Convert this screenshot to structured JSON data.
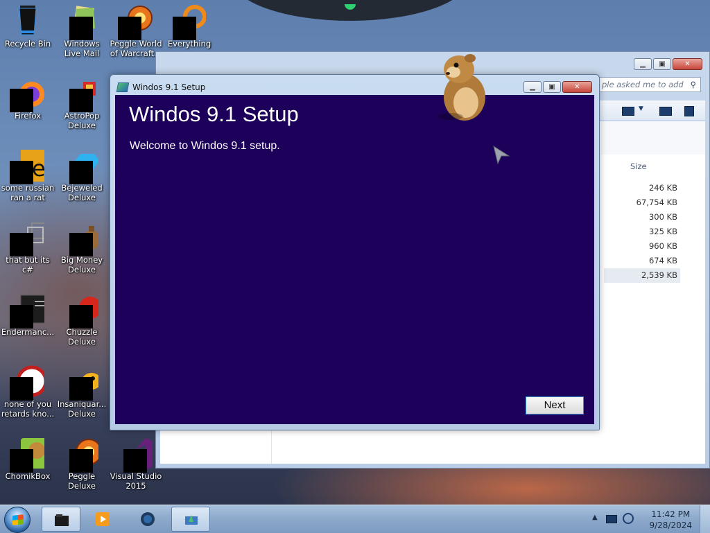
{
  "desktop": {
    "icons": [
      {
        "label": "Recycle Bin",
        "icon": "recycle-bin-icon"
      },
      {
        "label": "Windows Live Mail",
        "icon": "mail-icon"
      },
      {
        "label": "Peggle World of Warcraft...",
        "icon": "peggle-icon"
      },
      {
        "label": "Everything",
        "icon": "search-ring-icon"
      },
      {
        "label": "Firefox",
        "icon": "firefox-icon"
      },
      {
        "label": "AstroPop Deluxe",
        "icon": "astropop-icon"
      },
      {
        "label": "some russian ran a rat",
        "icon": "rat-app-icon"
      },
      {
        "label": "Bejeweled Deluxe",
        "icon": "gem-icon"
      },
      {
        "label": "that but its c#",
        "icon": "stack-icon"
      },
      {
        "label": "Big Money Deluxe",
        "icon": "money-bag-icon"
      },
      {
        "label": "Endermanc...",
        "icon": "terminal-icon"
      },
      {
        "label": "Chuzzle Deluxe",
        "icon": "chuzzle-icon"
      },
      {
        "label": "none of you retards kno...",
        "icon": "chrome-like-icon"
      },
      {
        "label": "Insaniquar... Deluxe",
        "icon": "fish-icon"
      },
      {
        "label": "ChomikBox",
        "icon": "hamster-box-icon"
      },
      {
        "label": "Peggle Deluxe",
        "icon": "peggle-icon"
      },
      {
        "label": "Visual Studio 2015",
        "icon": "visual-studio-icon"
      }
    ]
  },
  "explorer": {
    "search_placeholder": "ple asked me to add",
    "size_header": "Size",
    "sizes": [
      "246 KB",
      "67,754 KB",
      "300 KB",
      "325 KB",
      "960 KB",
      "674 KB",
      "2,539 KB"
    ]
  },
  "dialog": {
    "window_title": "Windos 9.1 Setup",
    "heading": "Windos 9.1 Setup",
    "welcome": "Welcome to Windos 9.1 setup.",
    "next_label": "Next",
    "client_color": "#1c005a"
  },
  "taskbar": {
    "time": "11:42 PM",
    "date": "9/28/2024"
  }
}
